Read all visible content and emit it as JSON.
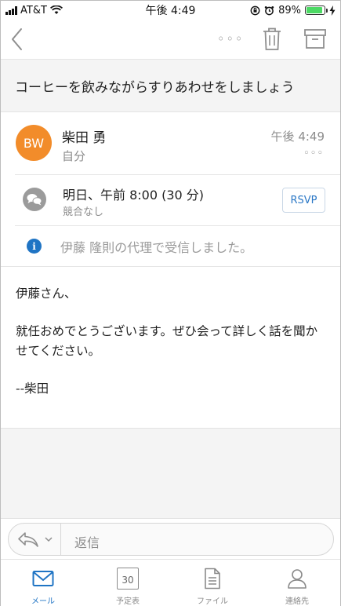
{
  "status_bar": {
    "carrier": "AT&T",
    "time": "午後 4:49",
    "battery_percent": "89%",
    "battery_level": 0.89,
    "icons": [
      "signal-icon",
      "wifi-icon",
      "orientation-lock-icon",
      "alarm-icon",
      "battery-icon",
      "charging-icon"
    ]
  },
  "nav": {
    "more": "◦◦◦",
    "icons": [
      "back-chevron-icon",
      "more-icon",
      "trash-icon",
      "archive-icon"
    ]
  },
  "message": {
    "subject": "コーヒーを飲みながらすりあわせをしましょう",
    "sender": {
      "initials": "BW",
      "name": "柴田 勇",
      "recipient": "自分",
      "time": "午後 4:49",
      "more": "◦◦◦",
      "avatar_color": "#f28c2a"
    },
    "event": {
      "title": "明日、午前 8:00 (30 分)",
      "conflict": "競合なし",
      "rsvp_label": "RSVP"
    },
    "info_notice": "伊藤 隆則の代理で受信しました。",
    "body": {
      "greeting": "伊藤さん、",
      "paragraph": "就任おめでとうございます。ぜひ会って詳しく話を聞かせてください。",
      "signature": "--柴田"
    }
  },
  "reply": {
    "placeholder": "返信"
  },
  "tabs": [
    {
      "label": "メール",
      "icon": "mail-icon",
      "active": true
    },
    {
      "label": "予定表",
      "icon": "calendar-icon",
      "active": false,
      "date": "30"
    },
    {
      "label": "ファイル",
      "icon": "file-icon",
      "active": false
    },
    {
      "label": "連絡先",
      "icon": "contact-icon",
      "active": false
    }
  ],
  "colors": {
    "accent": "#1f74c4",
    "avatar": "#f28c2a",
    "battery": "#4cd964"
  }
}
